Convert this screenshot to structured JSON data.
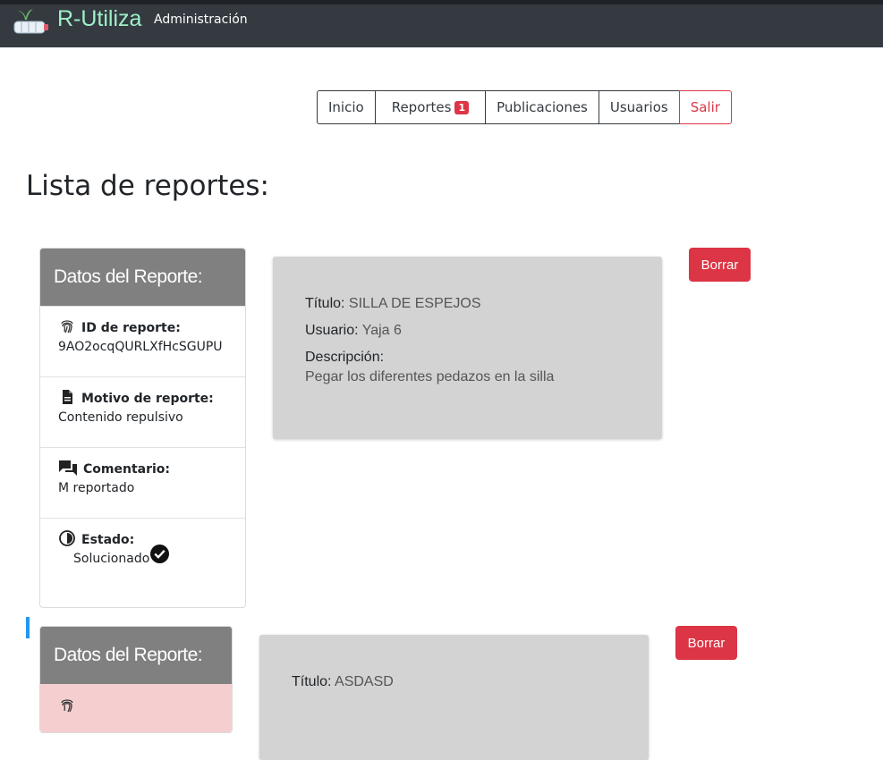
{
  "app": {
    "brand": "R-Utiliza",
    "section": "Administración"
  },
  "menu": [
    {
      "label": "Inicio"
    },
    {
      "label": "Reportes",
      "badge": "1"
    },
    {
      "label": "Publicaciones"
    },
    {
      "label": "Usuarios"
    },
    {
      "label": "Salir"
    }
  ],
  "page": {
    "title": "Lista de reportes:"
  },
  "reports": [
    {
      "header": "Datos del Reporte:",
      "id_label": "ID de reporte:",
      "id_value": "9AO2ocqQURLXfHcSGUPU",
      "motivo_label": "Motivo de reporte:",
      "motivo_value": "Contenido repulsivo",
      "comentario_label": "Comentario:",
      "comentario_value": "M reportado",
      "estado_label": "Estado:",
      "estado_value": "Solucionado",
      "titulo_label": "Título:",
      "titulo_value": "SILLA DE ESPEJOS",
      "usuario_label": "Usuario:",
      "usuario_value": "Yaja 6",
      "descripcion_label": "Descripción:",
      "descripcion_value": "Pegar los diferentes pedazos en la silla",
      "delete_label": "Borrar"
    },
    {
      "header": "Datos del Reporte:",
      "titulo_label": "Título:",
      "titulo_value": "ASDASD",
      "delete_label": "Borrar"
    }
  ],
  "colors": {
    "navbar": "#343a40",
    "brand": "#9ff0c8",
    "danger": "#dc3545",
    "card_header": "#808080",
    "card_body": "#d3d3d3"
  }
}
